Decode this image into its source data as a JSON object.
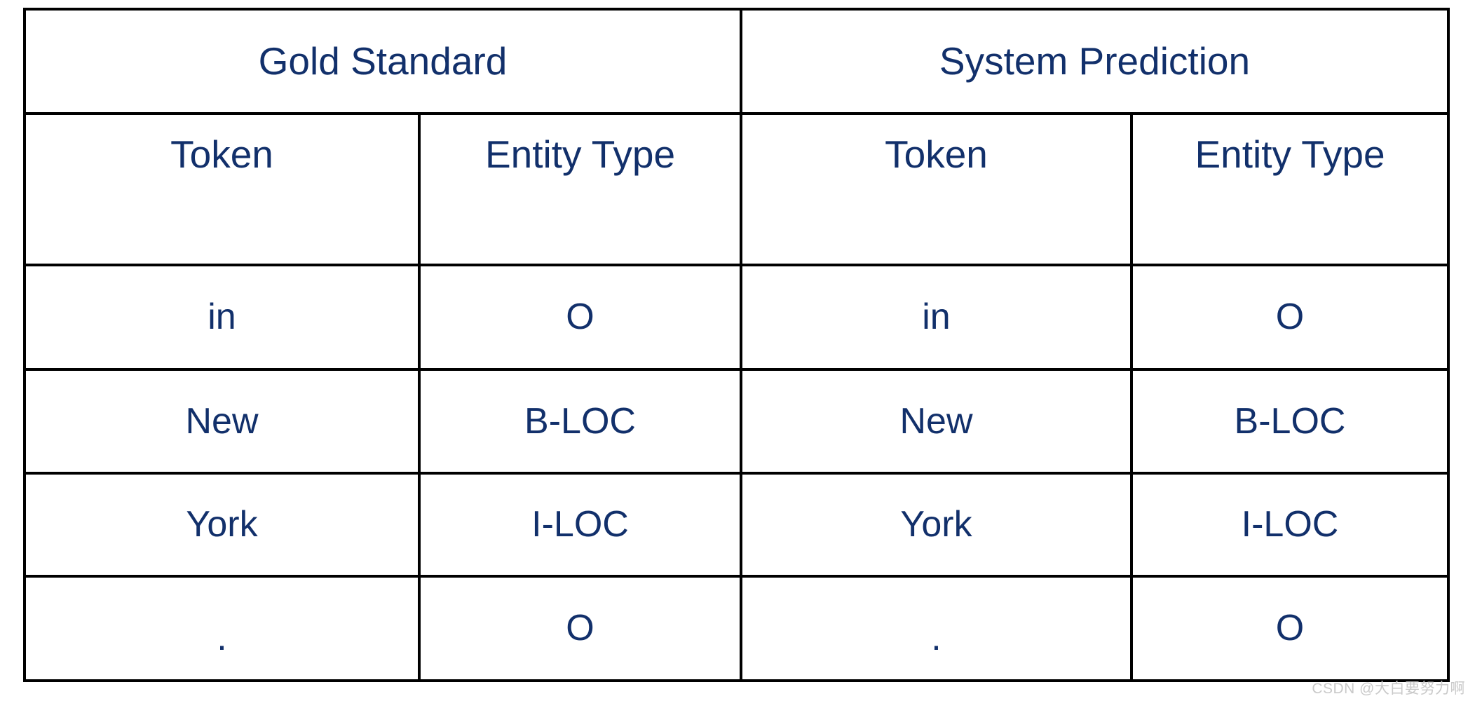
{
  "table": {
    "group_headers": [
      {
        "label": "Gold Standard",
        "span": 2
      },
      {
        "label": "System Prediction",
        "span": 2
      }
    ],
    "column_headers": [
      "Token",
      "Entity Type",
      "Token",
      "Entity Type"
    ],
    "rows": [
      {
        "gold_token": "in",
        "gold_entity": "O",
        "pred_token": "in",
        "pred_entity": "O"
      },
      {
        "gold_token": "New",
        "gold_entity": "B-LOC",
        "pred_token": "New",
        "pred_entity": "B-LOC"
      },
      {
        "gold_token": "York",
        "gold_entity": "I-LOC",
        "pred_token": "York",
        "pred_entity": "I-LOC"
      },
      {
        "gold_token": ".",
        "gold_entity": "O",
        "pred_token": ".",
        "pred_entity": "O"
      }
    ]
  },
  "watermark": {
    "text": "CSDN @大白要努力啊"
  },
  "colors": {
    "text": "#12306b",
    "border": "#000000",
    "background": "#ffffff",
    "watermark": "#c9c9c9"
  }
}
